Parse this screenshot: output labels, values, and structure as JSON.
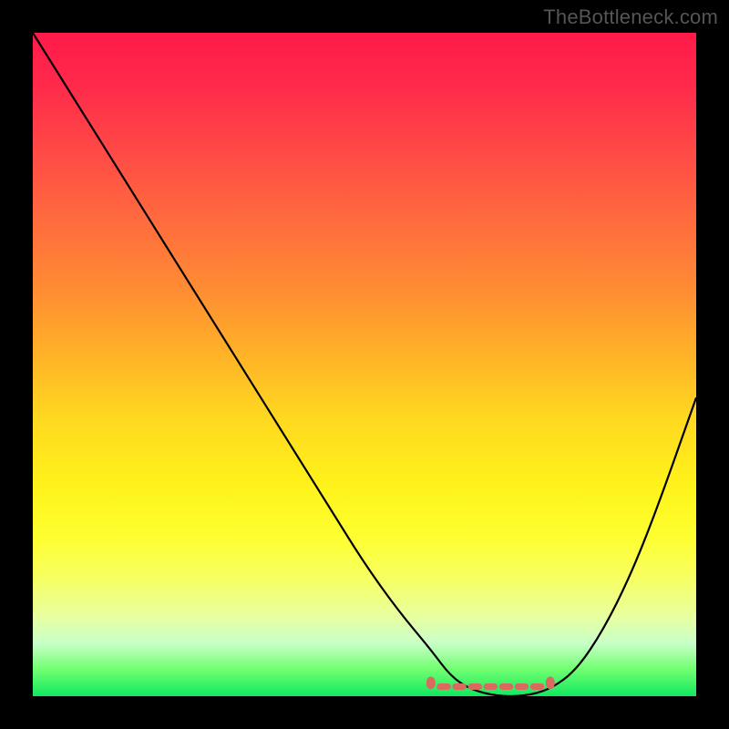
{
  "watermark": "TheBottleneck.com",
  "chart_data": {
    "type": "line",
    "title": "",
    "xlabel": "",
    "ylabel": "",
    "xlim": [
      0,
      100
    ],
    "ylim": [
      0,
      100
    ],
    "grid": false,
    "legend": false,
    "series": [
      {
        "name": "bottleneck-curve",
        "x": [
          0,
          5,
          10,
          15,
          20,
          25,
          30,
          35,
          40,
          45,
          50,
          55,
          60,
          63,
          66,
          70,
          74,
          78,
          82,
          86,
          90,
          94,
          100
        ],
        "y": [
          100,
          92,
          84,
          76,
          68,
          60,
          52,
          44,
          36,
          28,
          20,
          13,
          7,
          3,
          1,
          0,
          0,
          1,
          4,
          10,
          18,
          28,
          45
        ]
      }
    ],
    "highlight_region": {
      "name": "optimal-zone",
      "x_start": 60,
      "x_end": 78,
      "y": 2,
      "color": "#d86a60"
    }
  },
  "colors": {
    "background": "#000000",
    "gradient_top": "#ff1a4a",
    "gradient_bottom": "#10e860",
    "curve": "#000000",
    "highlight": "#d86a60",
    "watermark": "#555555"
  }
}
